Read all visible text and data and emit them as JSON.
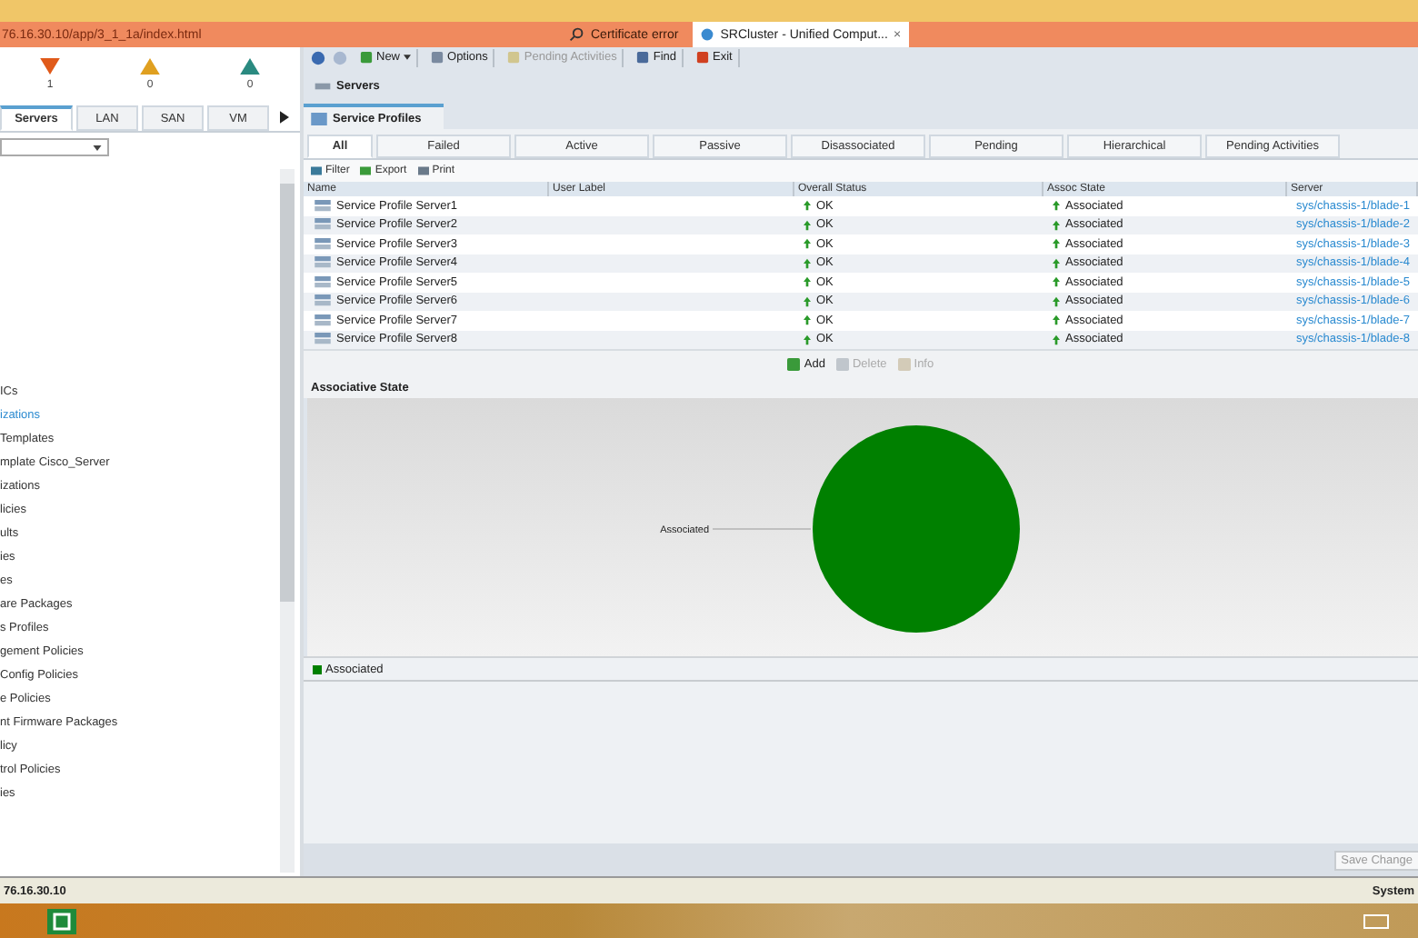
{
  "browser": {
    "address": "76.16.30.10/app/3_1_1a/index.html",
    "security": "Certificate error",
    "tab_title": "SRCluster - Unified Comput...",
    "tab_close": "×"
  },
  "faults": [
    {
      "kind": "critical",
      "count": "1"
    },
    {
      "kind": "major",
      "count": "0"
    },
    {
      "kind": "minor",
      "count": "0"
    }
  ],
  "nav_tabs": [
    {
      "label": "Servers",
      "selected": true
    },
    {
      "label": "LAN",
      "selected": false
    },
    {
      "label": "SAN",
      "selected": false
    },
    {
      "label": "VM",
      "selected": false
    }
  ],
  "tree": [
    {
      "label": "ICs",
      "selected": false
    },
    {
      "label": "izations",
      "selected": true
    },
    {
      "label": "Templates",
      "selected": false
    },
    {
      "label": "mplate Cisco_Server",
      "selected": false
    },
    {
      "label": "izations",
      "selected": false
    },
    {
      "label": "licies",
      "selected": false
    },
    {
      "label": "ults",
      "selected": false
    },
    {
      "label": "ies",
      "selected": false
    },
    {
      "label": "es",
      "selected": false
    },
    {
      "label": "are Packages",
      "selected": false
    },
    {
      "label": "s Profiles",
      "selected": false
    },
    {
      "label": "gement Policies",
      "selected": false
    },
    {
      "label": "Config Policies",
      "selected": false
    },
    {
      "label": "e Policies",
      "selected": false
    },
    {
      "label": "nt Firmware Packages",
      "selected": false
    },
    {
      "label": "licy",
      "selected": false
    },
    {
      "label": "trol Policies",
      "selected": false
    },
    {
      "label": "ies",
      "selected": false
    }
  ],
  "toolbar": [
    {
      "kind": "new",
      "label": "New",
      "disabled": false
    },
    {
      "kind": "options",
      "label": "Options",
      "disabled": false
    },
    {
      "kind": "pending",
      "label": "Pending Activities",
      "disabled": true
    },
    {
      "kind": "find",
      "label": "Find",
      "disabled": false
    },
    {
      "kind": "exit",
      "label": "Exit",
      "disabled": false
    }
  ],
  "breadcrumb": "Servers",
  "view_tab": "Service Profiles",
  "filter_tabs": [
    {
      "label": "All",
      "selected": true
    },
    {
      "label": "Failed",
      "selected": false
    },
    {
      "label": "Active",
      "selected": false
    },
    {
      "label": "Passive",
      "selected": false
    },
    {
      "label": "Disassociated",
      "selected": false
    },
    {
      "label": "Pending",
      "selected": false
    },
    {
      "label": "Hierarchical",
      "selected": false
    },
    {
      "label": "Pending Activities",
      "selected": false
    }
  ],
  "actions": [
    {
      "kind": "filter",
      "label": "Filter"
    },
    {
      "kind": "export",
      "label": "Export"
    },
    {
      "kind": "print",
      "label": "Print"
    }
  ],
  "table": {
    "columns": [
      "Name",
      "User Label",
      "Overall Status",
      "Assoc State",
      "Server"
    ],
    "rows": [
      {
        "name": "Service Profile Server1",
        "status": "OK",
        "assoc": "Associated",
        "server": "sys/chassis-1/blade-1"
      },
      {
        "name": "Service Profile Server2",
        "status": "OK",
        "assoc": "Associated",
        "server": "sys/chassis-1/blade-2"
      },
      {
        "name": "Service Profile Server3",
        "status": "OK",
        "assoc": "Associated",
        "server": "sys/chassis-1/blade-3"
      },
      {
        "name": "Service Profile Server4",
        "status": "OK",
        "assoc": "Associated",
        "server": "sys/chassis-1/blade-4"
      },
      {
        "name": "Service Profile Server5",
        "status": "OK",
        "assoc": "Associated",
        "server": "sys/chassis-1/blade-5"
      },
      {
        "name": "Service Profile Server6",
        "status": "OK",
        "assoc": "Associated",
        "server": "sys/chassis-1/blade-6"
      },
      {
        "name": "Service Profile Server7",
        "status": "OK",
        "assoc": "Associated",
        "server": "sys/chassis-1/blade-7"
      },
      {
        "name": "Service Profile Server8",
        "status": "OK",
        "assoc": "Associated",
        "server": "sys/chassis-1/blade-8"
      }
    ]
  },
  "row_actions": [
    {
      "kind": "add",
      "label": "Add",
      "disabled": false
    },
    {
      "kind": "delete",
      "label": "Delete",
      "disabled": true
    },
    {
      "kind": "info",
      "label": "Info",
      "disabled": true
    }
  ],
  "associative_state": {
    "title": "Associative State",
    "slice_label": "Associated",
    "legend": [
      {
        "label": "Associated",
        "color": "#008000"
      }
    ]
  },
  "save_button": {
    "label": "Save Change",
    "disabled": true
  },
  "status_bar": {
    "address": "76.16.30.10",
    "user": "System"
  }
}
